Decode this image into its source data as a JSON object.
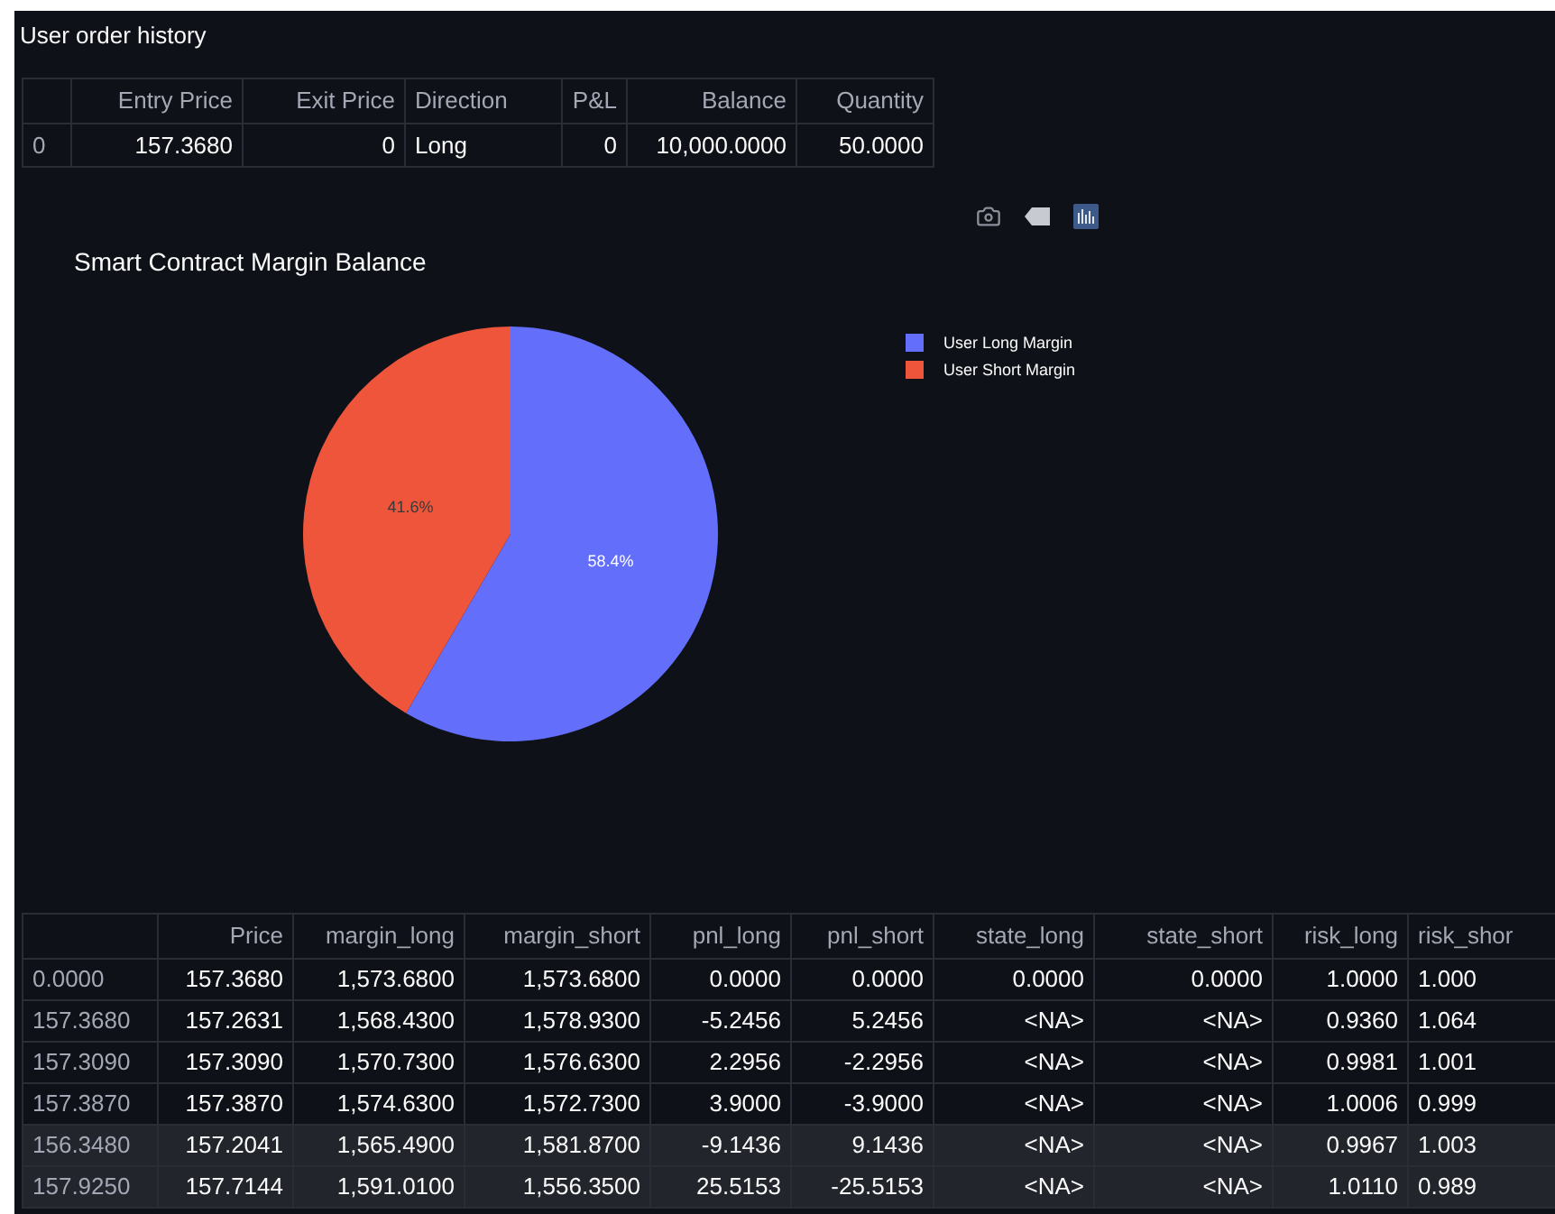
{
  "order_history": {
    "title": "User order history",
    "columns": [
      "",
      "Entry Price",
      "Exit Price",
      "Direction",
      "P&L",
      "Balance",
      "Quantity"
    ],
    "rows": [
      [
        "0",
        "157.3680",
        "0",
        "Long",
        "0",
        "10,000.0000",
        "50.0000"
      ]
    ]
  },
  "chart": {
    "title": "Smart Contract Margin Balance",
    "legend": [
      {
        "color": "#636efa"
      },
      {
        "color": "#ef553b"
      }
    ],
    "chart_data": {
      "type": "pie",
      "categories": [
        "User Long Margin",
        "User Short Margin"
      ],
      "series": [
        {
          "values": [
            58.4,
            41.6
          ]
        }
      ],
      "value_labels": [
        "58.4%",
        "41.6%"
      ]
    }
  },
  "margin_table": {
    "columns": [
      "",
      "Price",
      "margin_long",
      "margin_short",
      "pnl_long",
      "pnl_short",
      "state_long",
      "state_short",
      "risk_long",
      "risk_shor"
    ],
    "rows": [
      {
        "highlighted": false,
        "cells": [
          "0.0000",
          "157.3680",
          "1,573.6800",
          "1,573.6800",
          "0.0000",
          "0.0000",
          "0.0000",
          "0.0000",
          "1.0000",
          "1.000"
        ]
      },
      {
        "highlighted": false,
        "cells": [
          "157.3680",
          "157.2631",
          "1,568.4300",
          "1,578.9300",
          "-5.2456",
          "5.2456",
          "<NA>",
          "<NA>",
          "0.9360",
          "1.064"
        ]
      },
      {
        "highlighted": false,
        "cells": [
          "157.3090",
          "157.3090",
          "1,570.7300",
          "1,576.6300",
          "2.2956",
          "-2.2956",
          "<NA>",
          "<NA>",
          "0.9981",
          "1.001"
        ]
      },
      {
        "highlighted": false,
        "cells": [
          "157.3870",
          "157.3870",
          "1,574.6300",
          "1,572.7300",
          "3.9000",
          "-3.9000",
          "<NA>",
          "<NA>",
          "1.0006",
          "0.999"
        ]
      },
      {
        "highlighted": true,
        "cells": [
          "156.3480",
          "157.2041",
          "1,565.4900",
          "1,581.8700",
          "-9.1436",
          "9.1436",
          "<NA>",
          "<NA>",
          "0.9967",
          "1.003"
        ]
      },
      {
        "highlighted": true,
        "cells": [
          "157.9250",
          "157.7144",
          "1,591.0100",
          "1,556.3500",
          "25.5153",
          "-25.5153",
          "<NA>",
          "<NA>",
          "1.0110",
          "0.989"
        ]
      }
    ]
  }
}
